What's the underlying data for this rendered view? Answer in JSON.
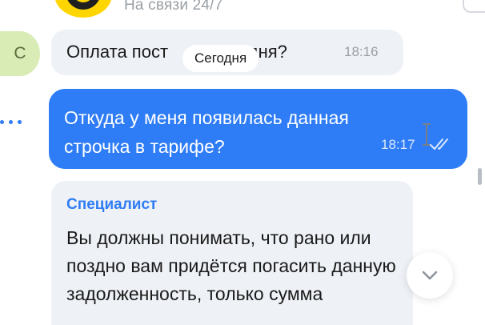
{
  "header": {
    "status": "На связи 24/7",
    "logo_color": "#ffd500"
  },
  "messages": [
    {
      "direction": "incoming",
      "avatar_letter": "С",
      "text": "Оплата пост",
      "text_tail": "одня?",
      "time": "18:16"
    },
    {
      "direction": "outgoing",
      "text": "Откуда у меня появилась данная строчка в тарифе?",
      "time": "18:17",
      "status_icon": "double-check-icon"
    },
    {
      "direction": "incoming",
      "sender": "Специалист",
      "text": "Вы должны понимать, что рано или поздно вам придётся погасить данную задолженность, только сумма"
    }
  ],
  "date_chip": "Сегодня",
  "icons": {
    "more": "more-dots-icon",
    "scroll_down": "chevron-down-icon",
    "cursor": "text-cursor-icon"
  },
  "colors": {
    "accent": "#2f7df6",
    "incoming_bubble": "#eef1f6",
    "avatar_bg": "#d9ecb6"
  }
}
